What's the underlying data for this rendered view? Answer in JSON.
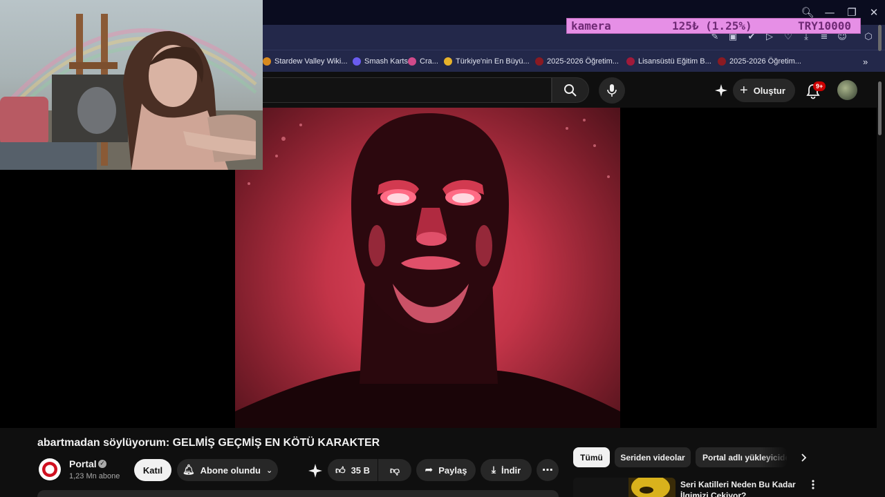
{
  "browser": {
    "bookmarks": [
      {
        "label": "Stardew Valley Wiki...",
        "icon": "stardew-icon",
        "color": "#d98a1e"
      },
      {
        "label": "Smash Karts",
        "icon": "smash-karts-icon",
        "color": "#6a5cf0"
      },
      {
        "label": "Cra...",
        "icon": "cra-icon",
        "color": "#d04a8a"
      },
      {
        "label": "Türkiye'nin En Büyü...",
        "icon": "turkey-site-icon",
        "color": "#e7b22a"
      },
      {
        "label": "2025-2026 Öğretim...",
        "icon": "university-icon",
        "color": "#8a1a22"
      },
      {
        "label": "Lisansüstü Eğitim B...",
        "icon": "university-icon",
        "color": "#a01a3a"
      },
      {
        "label": "2025-2026 Öğretim...",
        "icon": "university-icon",
        "color": "#8a1a22"
      }
    ]
  },
  "overlay": {
    "label": "kamera",
    "price": "125₺ (1.25%)",
    "goal": "TRY10000",
    "background": "#e68fe6"
  },
  "youtube": {
    "create_label": "Oluştur",
    "notification_count": "9+",
    "video": {
      "title": "abartmadan söylüyorum: GELMİŞ GEÇMİŞ EN KÖTÜ KARAKTER",
      "channel": "Portal",
      "subscribers": "1,23 Mn abone",
      "join_label": "Katıl",
      "subscribed_label": "Abone olundu",
      "likes": "35 B",
      "share_label": "Paylaş",
      "download_label": "İndir"
    },
    "chips": [
      "Tümü",
      "Seriden videolar",
      "Portal adlı yükleyicide"
    ],
    "related": [
      {
        "title": "Seri Katilleri Neden Bu Kadar İlgimizi Çekiyor?"
      }
    ]
  }
}
